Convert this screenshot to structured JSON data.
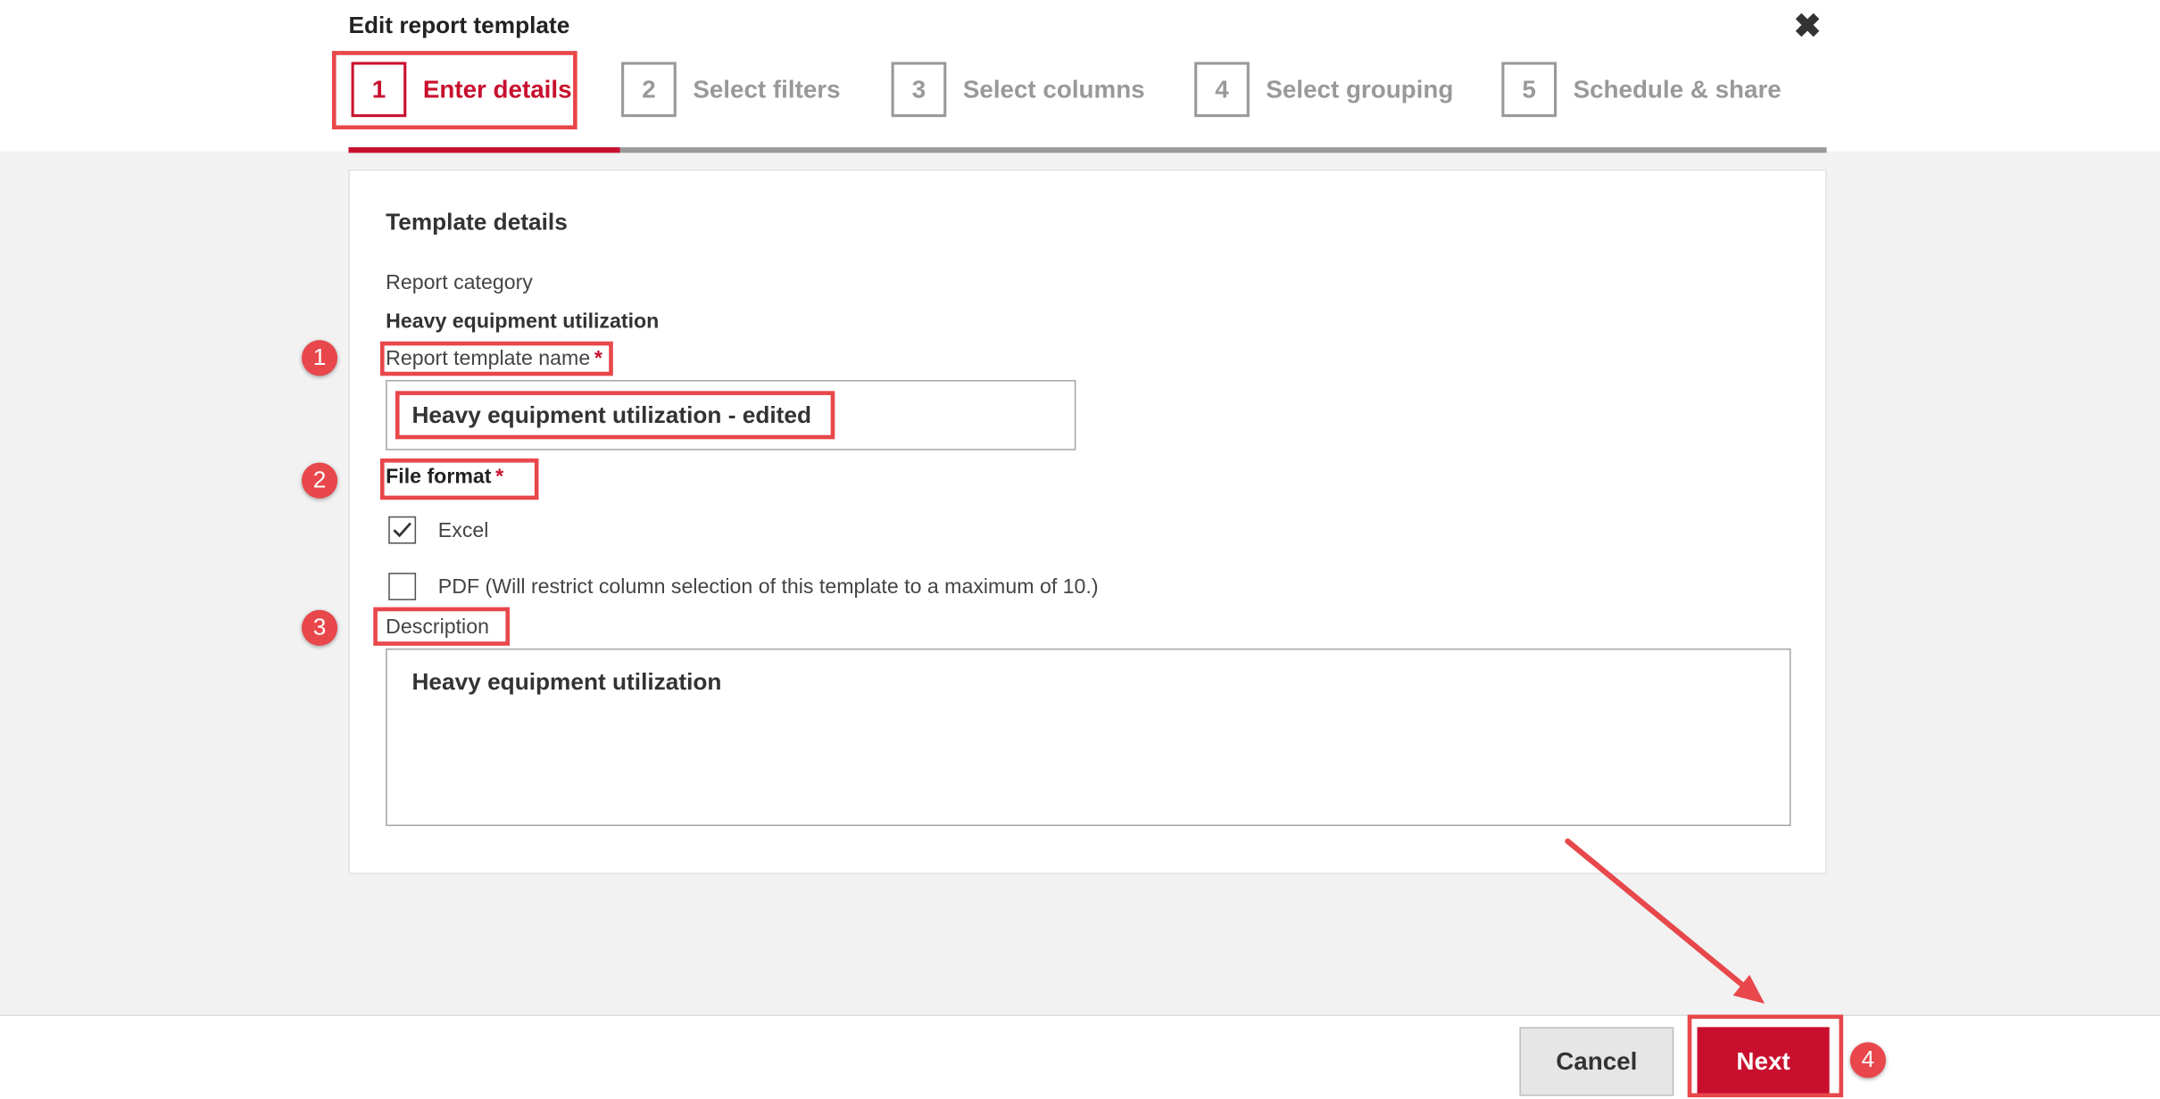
{
  "dialog": {
    "title": "Edit report template"
  },
  "steps": [
    {
      "number": "1",
      "label": "Enter details"
    },
    {
      "number": "2",
      "label": "Select filters"
    },
    {
      "number": "3",
      "label": "Select columns"
    },
    {
      "number": "4",
      "label": "Select grouping"
    },
    {
      "number": "5",
      "label": "Schedule & share"
    }
  ],
  "form": {
    "section_title": "Template details",
    "category_label": "Report category",
    "category_value": "Heavy equipment utilization",
    "name_label": "Report template name",
    "required_mark": "*",
    "name_value": "Heavy equipment utilization - edited",
    "file_format_label": "File format",
    "excel_label": "Excel",
    "excel_checked": true,
    "pdf_label": "PDF (Will restrict column selection of this template to a maximum of 10.)",
    "pdf_checked": false,
    "description_label": "Description",
    "description_value": "Heavy equipment utilization"
  },
  "footer": {
    "cancel_label": "Cancel",
    "next_label": "Next"
  },
  "annotations": {
    "badge1": "1",
    "badge2": "2",
    "badge3": "3",
    "badge4": "4"
  },
  "colors": {
    "accent": "#c8102e",
    "annotation": "#e8474b",
    "inactive": "#999999"
  }
}
